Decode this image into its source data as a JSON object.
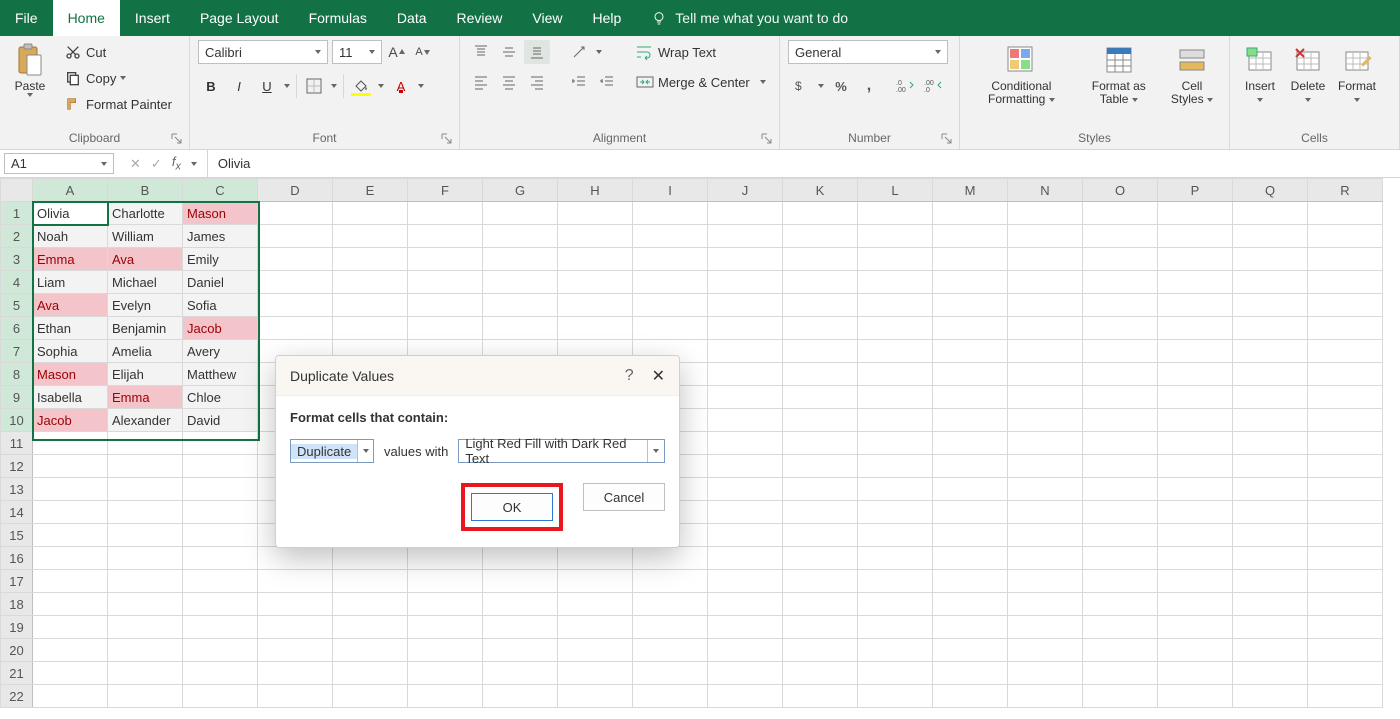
{
  "menu": {
    "tabs": [
      "File",
      "Home",
      "Insert",
      "Page Layout",
      "Formulas",
      "Data",
      "Review",
      "View",
      "Help"
    ],
    "active_index": 1,
    "tell_me": "Tell me what you want to do"
  },
  "ribbon": {
    "clipboard": {
      "paste": "Paste",
      "cut": "Cut",
      "copy": "Copy",
      "format_painter": "Format Painter",
      "label": "Clipboard"
    },
    "font": {
      "name": "Calibri",
      "size": "11",
      "label": "Font"
    },
    "alignment": {
      "wrap": "Wrap Text",
      "merge": "Merge & Center",
      "label": "Alignment"
    },
    "number": {
      "format": "General",
      "label": "Number"
    },
    "styles": {
      "cond": "Conditional Formatting",
      "table_fmt": "Format as Table",
      "cell_styles": "Cell Styles",
      "label": "Styles"
    },
    "cells": {
      "insert": "Insert",
      "delete": "Delete",
      "format": "Format",
      "label": "Cells"
    }
  },
  "formula_bar": {
    "name_box": "A1",
    "fx_value": "Olivia"
  },
  "grid": {
    "columns": [
      "A",
      "B",
      "C",
      "D",
      "E",
      "F",
      "G",
      "H",
      "I",
      "J",
      "K",
      "L",
      "M",
      "N",
      "O",
      "P",
      "Q",
      "R"
    ],
    "sel_cols": [
      "A",
      "B",
      "C"
    ],
    "rows": 22,
    "sel_rows": 10,
    "data": [
      [
        "Olivia",
        "Charlotte",
        "Mason"
      ],
      [
        "Noah",
        "William",
        "James"
      ],
      [
        "Emma",
        "Ava",
        "Emily"
      ],
      [
        "Liam",
        "Michael",
        "Daniel"
      ],
      [
        "Ava",
        "Evelyn",
        "Sofia"
      ],
      [
        "Ethan",
        "Benjamin",
        "Jacob"
      ],
      [
        "Sophia",
        "Amelia",
        "Avery"
      ],
      [
        "Mason",
        "Elijah",
        "Matthew"
      ],
      [
        "Isabella",
        "Emma",
        "Chloe"
      ],
      [
        "Jacob",
        "Alexander",
        "David"
      ]
    ],
    "duplicates": [
      [
        0,
        2
      ],
      [
        2,
        0
      ],
      [
        2,
        1
      ],
      [
        4,
        0
      ],
      [
        5,
        2
      ],
      [
        7,
        0
      ],
      [
        8,
        1
      ],
      [
        9,
        0
      ]
    ],
    "active_cell": [
      0,
      0
    ]
  },
  "dialog": {
    "title": "Duplicate Values",
    "help": "?",
    "subtitle": "Format cells that contain:",
    "rule_type": "Duplicate",
    "middle_text": "values with",
    "format_option": "Light Red Fill with Dark Red Text",
    "ok": "OK",
    "cancel": "Cancel"
  }
}
